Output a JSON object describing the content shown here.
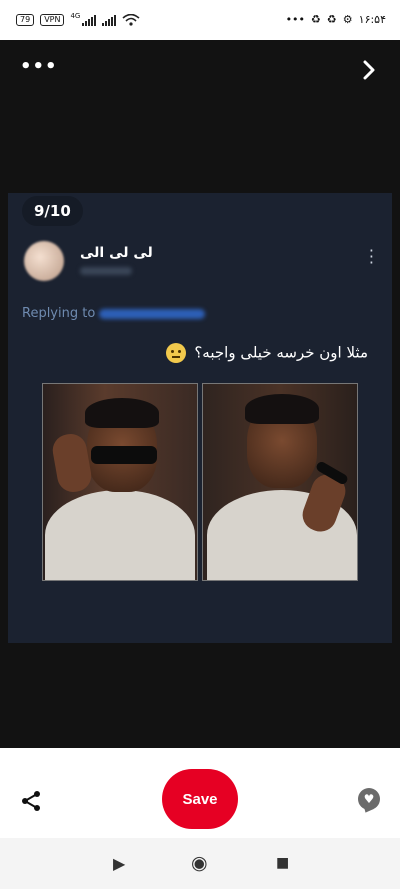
{
  "status_bar": {
    "battery": "79",
    "vpn": "VPN",
    "network": "4G",
    "time": "۱۶:۵۴",
    "more_dots": "•••"
  },
  "viewer": {
    "counter": "9/10",
    "more_icon": "three-dots-horizontal-icon",
    "next_icon": "chevron-right-icon"
  },
  "tweet": {
    "author_name": "لی لی الی",
    "replying_to_label": "Replying to",
    "text": "مثلا اون خرسه خیلی واجبه؟",
    "emoji": "neutral-face-emoji"
  },
  "bottom_bar": {
    "save_label": "Save",
    "accent_color": "#e60023"
  },
  "nav": {
    "back": "▶",
    "home": "◉",
    "recents": "■"
  }
}
